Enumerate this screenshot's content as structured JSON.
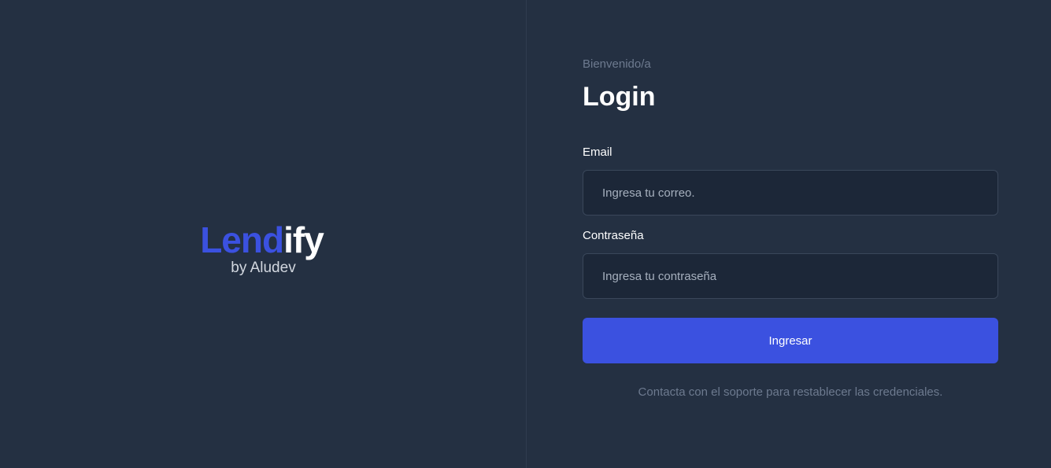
{
  "brand": {
    "name_part1": "Lend",
    "name_part2": "ify",
    "subtitle": "by Aludev"
  },
  "login": {
    "welcome": "Bienvenido/a",
    "title": "Login",
    "email_label": "Email",
    "email_placeholder": "Ingresa tu correo.",
    "password_label": "Contraseña",
    "password_placeholder": "Ingresa tu contraseña",
    "submit_label": "Ingresar",
    "support_note": "Contacta con el soporte para restablecer las credenciales."
  },
  "colors": {
    "background": "#243042",
    "accent": "#3b51e0",
    "input_background": "#1c2738",
    "muted_text": "#6d7a8f"
  }
}
